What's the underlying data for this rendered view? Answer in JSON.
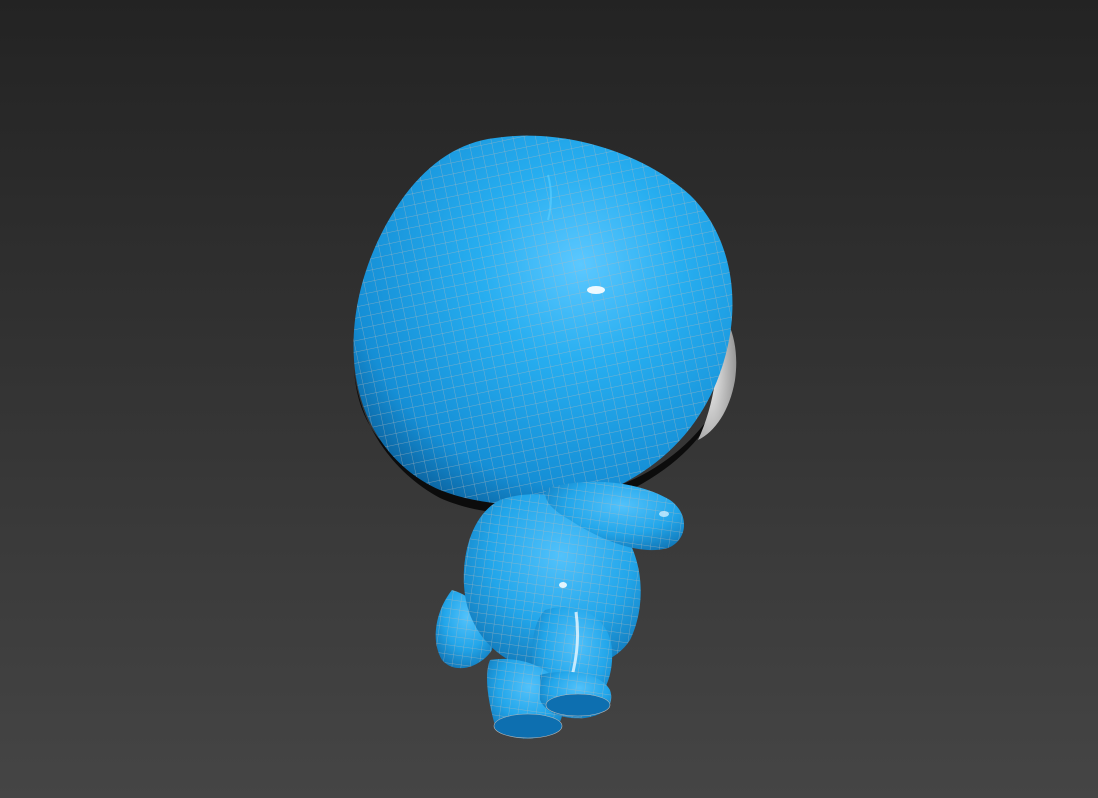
{
  "viewport": {
    "background_top": "#232323",
    "background_bottom": "#454545"
  },
  "model": {
    "body_color": "#1ea6ec",
    "body_highlight": "#5cc8ff",
    "body_shadow": "#0a5e99",
    "face_color": "#d9d9d9",
    "wire_color": "#b0b0b0"
  }
}
